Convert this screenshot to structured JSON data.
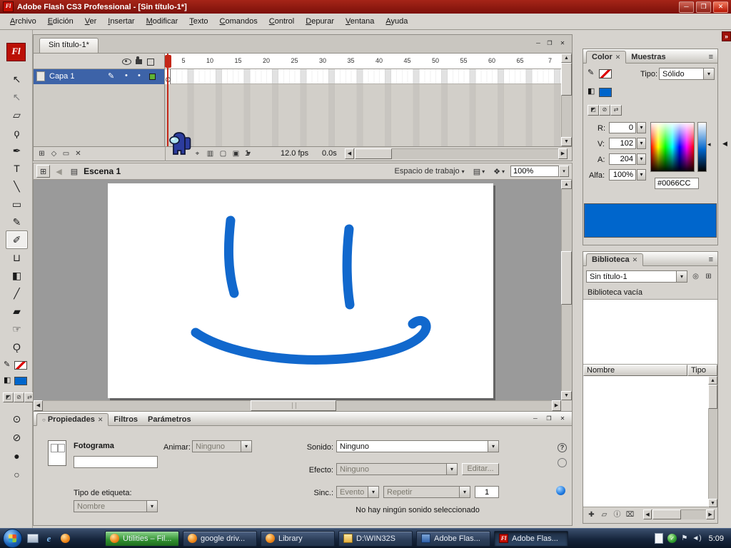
{
  "window": {
    "title": "Adobe Flash CS3 Professional - [Sin título-1*]",
    "app_badge": "Fl",
    "controls": {
      "minimize": "─",
      "maximize": "❐",
      "close": "✕"
    }
  },
  "menubar": {
    "items": [
      "Archivo",
      "Edición",
      "Ver",
      "Insertar",
      "Modificar",
      "Texto",
      "Comandos",
      "Control",
      "Depurar",
      "Ventana",
      "Ayuda"
    ]
  },
  "toolbar": {
    "logo": "Fl",
    "collapse_left": "»",
    "collapse_right": "»",
    "tools": [
      {
        "name": "selection",
        "glyph": "↖"
      },
      {
        "name": "subselection",
        "glyph": "↖"
      },
      {
        "name": "free-transform",
        "glyph": "▱"
      },
      {
        "name": "lasso",
        "glyph": "ϙ"
      },
      {
        "name": "pen",
        "glyph": "✒"
      },
      {
        "name": "text",
        "glyph": "T"
      },
      {
        "name": "line",
        "glyph": "╲"
      },
      {
        "name": "rectangle",
        "glyph": "▭"
      },
      {
        "name": "pencil",
        "glyph": "✎"
      },
      {
        "name": "brush",
        "glyph": "✐"
      },
      {
        "name": "ink-bottle",
        "glyph": "⊔"
      },
      {
        "name": "paint-bucket",
        "glyph": "◧"
      },
      {
        "name": "eyedropper",
        "glyph": "╱"
      },
      {
        "name": "eraser",
        "glyph": "▰"
      },
      {
        "name": "hand",
        "glyph": "☞"
      },
      {
        "name": "zoom",
        "glyph": "Ǫ"
      }
    ],
    "options": [
      {
        "name": "brush-mode",
        "glyph": "⊙"
      },
      {
        "name": "lock-fill",
        "glyph": "⊘"
      },
      {
        "name": "brush-size",
        "glyph": "●"
      },
      {
        "name": "brush-shape",
        "glyph": "○"
      }
    ]
  },
  "document": {
    "tab": "Sin título-1*"
  },
  "timeline": {
    "layer_name": "Capa 1",
    "ruler": [
      "5",
      "10",
      "15",
      "20",
      "25",
      "30",
      "35",
      "40",
      "45",
      "50",
      "55",
      "60",
      "65",
      "7"
    ],
    "current_frame": "1",
    "frame_rate": "12.0 fps",
    "elapsed_time": "0.0s"
  },
  "editbar": {
    "scene_name": "Escena 1",
    "workspace_label": "Espacio de trabajo",
    "zoom_value": "100%"
  },
  "color_panel": {
    "tab_color": "Color",
    "tab_muestras": "Muestras",
    "tipo_label": "Tipo:",
    "tipo_value": "Sólido",
    "r_label": "R:",
    "r_value": "0",
    "g_label": "V:",
    "g_value": "102",
    "b_label": "A:",
    "b_value": "204",
    "alpha_label": "Alfa:",
    "alpha_value": "100%",
    "hex_value": "#0066CC"
  },
  "library_panel": {
    "tab": "Biblioteca",
    "document_select": "Sin título-1",
    "empty_text": "Biblioteca vacía",
    "col_name": "Nombre",
    "col_type": "Tipo"
  },
  "properties_panel": {
    "tab_propiedades": "Propiedades",
    "tab_filtros": "Filtros",
    "tab_parametros": "Parámetros",
    "fotograma_label": "Fotograma",
    "frame_label_value": "",
    "animar_label": "Animar:",
    "animar_value": "Ninguno",
    "tipo_etiqueta_label": "Tipo de etiqueta:",
    "tipo_etiqueta_value": "Nombre",
    "sonido_label": "Sonido:",
    "sonido_value": "Ninguno",
    "efecto_label": "Efecto:",
    "efecto_value": "Ninguno",
    "editar_button": "Editar...",
    "sinc_label": "Sinc.:",
    "sinc_value": "Evento",
    "repetir_value": "Repetir",
    "repetir_count": "1",
    "status_text": "No hay ningún sonido seleccionado"
  },
  "colors": {
    "accent": "#0066CC",
    "drawing_stroke": "#1168CD",
    "titlebar_red": "#9A1A10",
    "layer_selected_blue": "#3D63A8",
    "stage_gray": "#9A9A9A"
  },
  "taskbar": {
    "buttons": [
      {
        "label": "Utilities – Fil..."
      },
      {
        "label": "google driv..."
      },
      {
        "label": "Library"
      },
      {
        "label": "D:\\WIN32S"
      },
      {
        "label": "Adobe Flas..."
      },
      {
        "label": "Adobe Flas..."
      }
    ],
    "clock": "5:09"
  },
  "glyphs": {
    "dropdown": "▾",
    "close": "✕",
    "minimize": "─",
    "restore": "❐",
    "menu": "≡",
    "up": "▲",
    "down": "▼",
    "left": "◀",
    "right": "▶",
    "back": "◀",
    "pencil": "✎",
    "dot": "•",
    "tab_bullet": "○",
    "center_frame": "⌖",
    "onion_skin": "▥",
    "onion_outline": "▢",
    "edit_multiple": "▣",
    "modify_markers": "▾",
    "insert_layer": "⊞",
    "motion_guide": "◇",
    "layer_folder": "▭",
    "delete_layer": "✕",
    "default_colors": "◩",
    "no_color": "⊘",
    "swap_colors": "⇄",
    "stroke_icon": "✎",
    "fill_icon": "◧",
    "pan": "⊞",
    "scene_icon": "▤",
    "edit_scene": "▤",
    "edit_symbols": "❖",
    "pin": "◎",
    "new_panel": "⊞",
    "new_symbol": "✚",
    "new_folder": "▱",
    "lib_props": "ⓘ",
    "lib_delete": "⌧",
    "help": "?",
    "flag": "⚑",
    "speaker": "◄)",
    "ie": "e",
    "check": "✓",
    "spectrum_arrow": "◂",
    "collapse_arrow": "◀"
  }
}
